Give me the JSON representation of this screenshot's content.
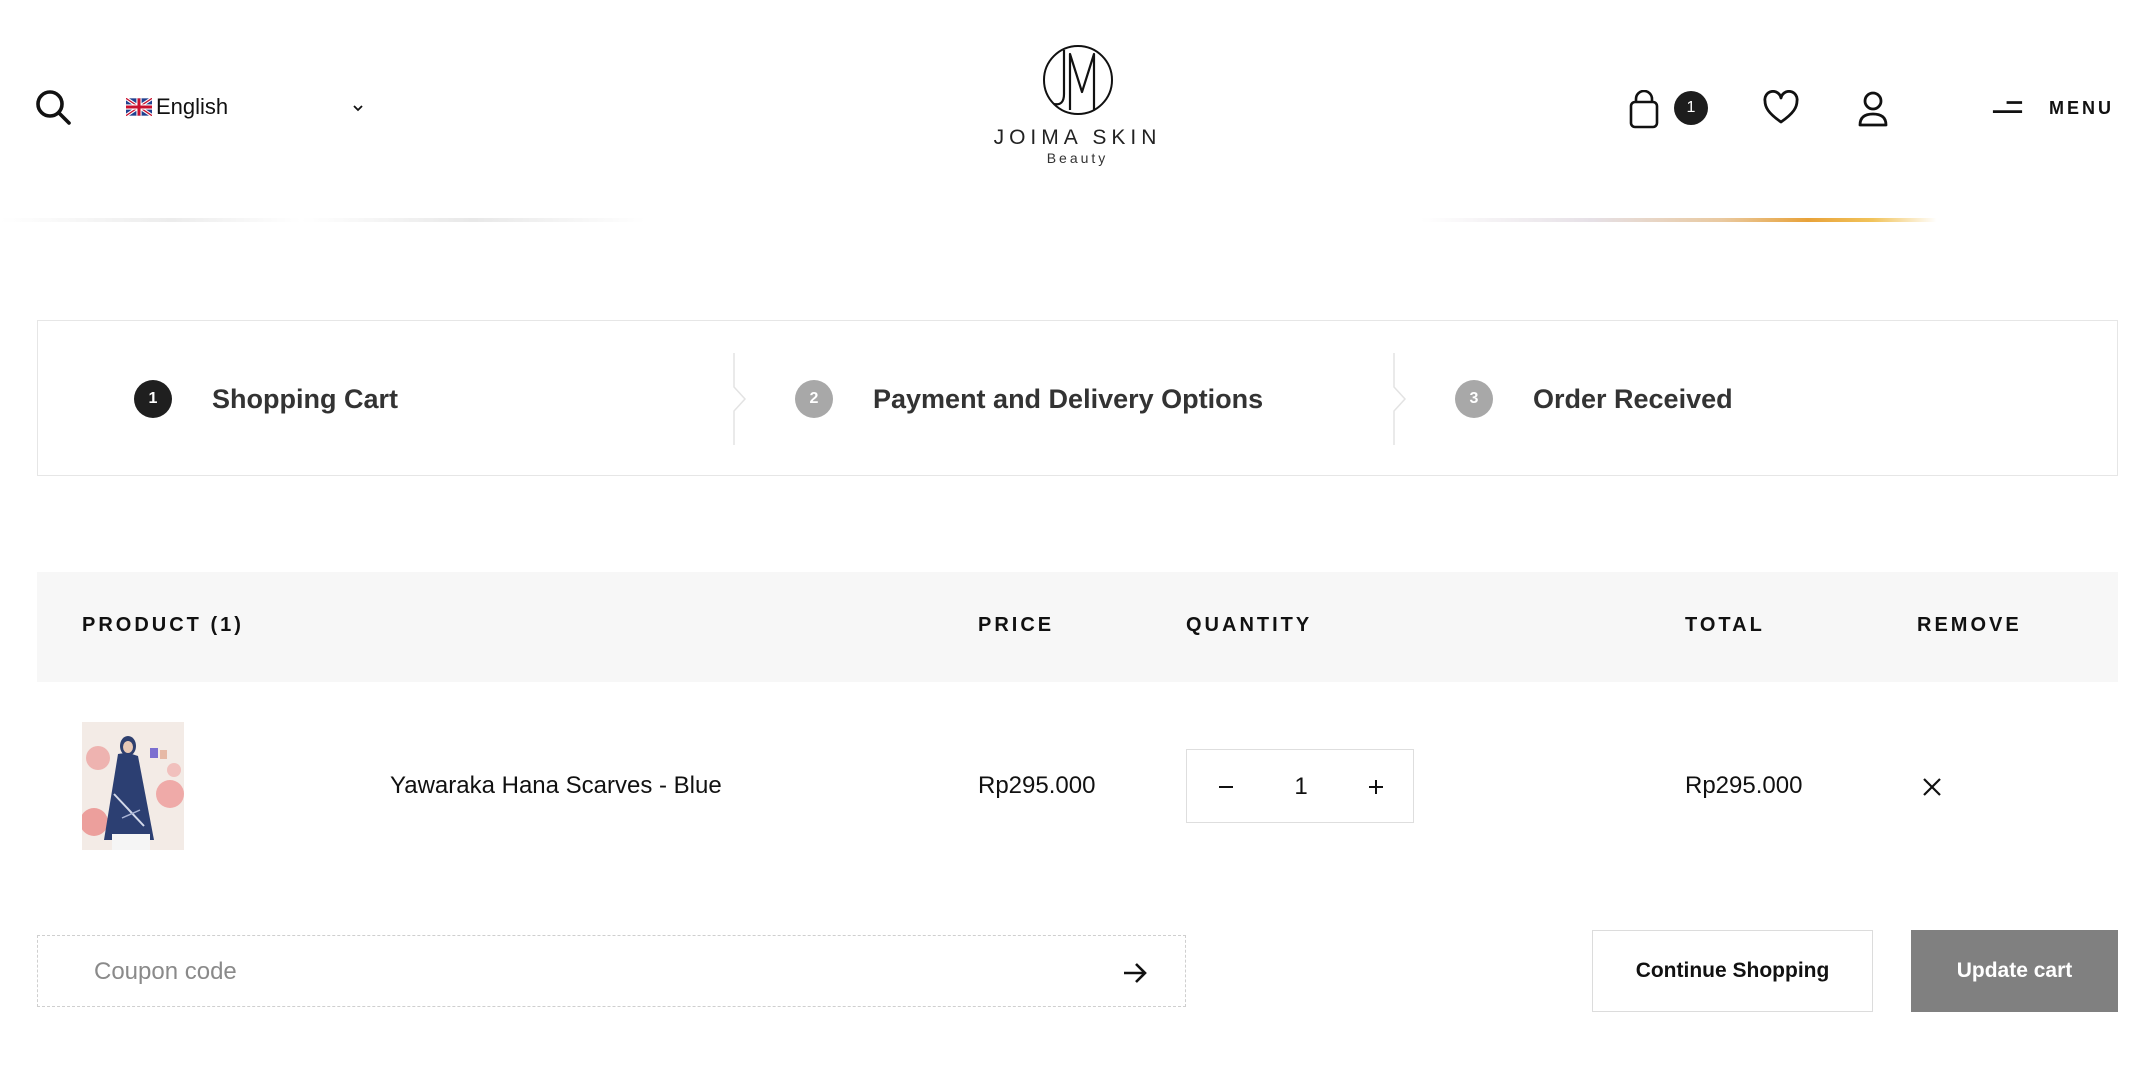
{
  "header": {
    "language": {
      "label": "English",
      "flag": "uk-flag-icon"
    },
    "logo": {
      "name": "JOIMA SKIN",
      "subtitle": "Beauty"
    },
    "cart_count": "1",
    "menu_label": "MENU",
    "icons": [
      "search-icon",
      "chevron-down-icon",
      "shopping-bag-icon",
      "heart-icon",
      "user-icon",
      "hamburger-icon"
    ]
  },
  "steps": [
    {
      "number": "1",
      "label": "Shopping Cart",
      "state": "active"
    },
    {
      "number": "2",
      "label": "Payment and Delivery Options",
      "state": "inactive"
    },
    {
      "number": "3",
      "label": "Order Received",
      "state": "inactive"
    }
  ],
  "cart_table": {
    "columns": {
      "product": "PRODUCT (1)",
      "price": "PRICE",
      "quantity": "QUANTITY",
      "total": "TOTAL",
      "remove": "REMOVE"
    },
    "items": [
      {
        "name": "Yawaraka Hana Scarves - Blue",
        "price": "Rp295.000",
        "quantity": "1",
        "total": "Rp295.000"
      }
    ]
  },
  "coupon": {
    "placeholder": "Coupon code",
    "value": ""
  },
  "actions": {
    "continue_shopping": "Continue Shopping",
    "update_cart": "Update cart"
  },
  "colors": {
    "step_active": "#1f1f1f",
    "step_inactive": "#a8a8a8",
    "table_header_bg": "#f7f7f7",
    "update_button_bg": "#808080"
  }
}
